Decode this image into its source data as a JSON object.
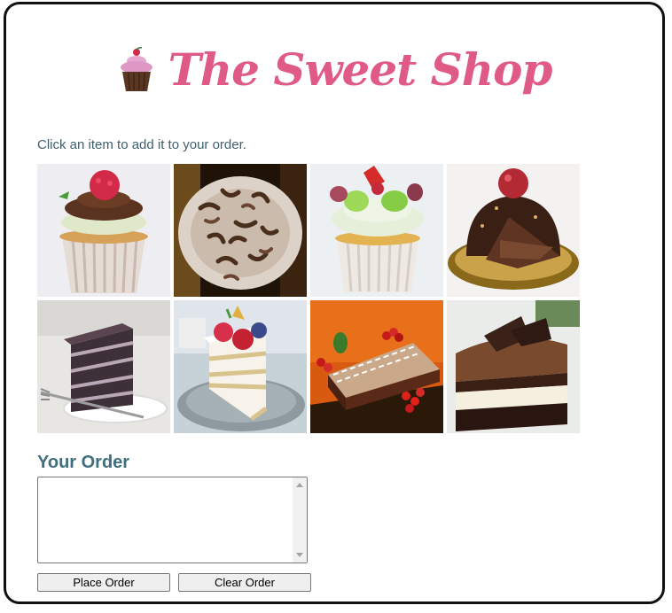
{
  "header": {
    "title": "The Sweet Shop",
    "logo_icon": "cupcake-icon",
    "title_color": "#e05a86"
  },
  "instructions": "Click an item to add it to your order.",
  "menu": {
    "items": [
      {
        "icon": "raspberry-cupcake-icon"
      },
      {
        "icon": "chocolate-curl-cupcake-icon"
      },
      {
        "icon": "fruit-cupcake-icon"
      },
      {
        "icon": "chocolate-dome-cake-icon"
      },
      {
        "icon": "layered-chocolate-cake-slice-icon"
      },
      {
        "icon": "berry-cream-cake-slice-icon"
      },
      {
        "icon": "chocolate-mousse-cake-icon"
      },
      {
        "icon": "triple-chocolate-cake-slice-icon"
      }
    ]
  },
  "order": {
    "heading": "Your Order",
    "value": "",
    "place_label": "Place Order",
    "clear_label": "Clear Order"
  }
}
